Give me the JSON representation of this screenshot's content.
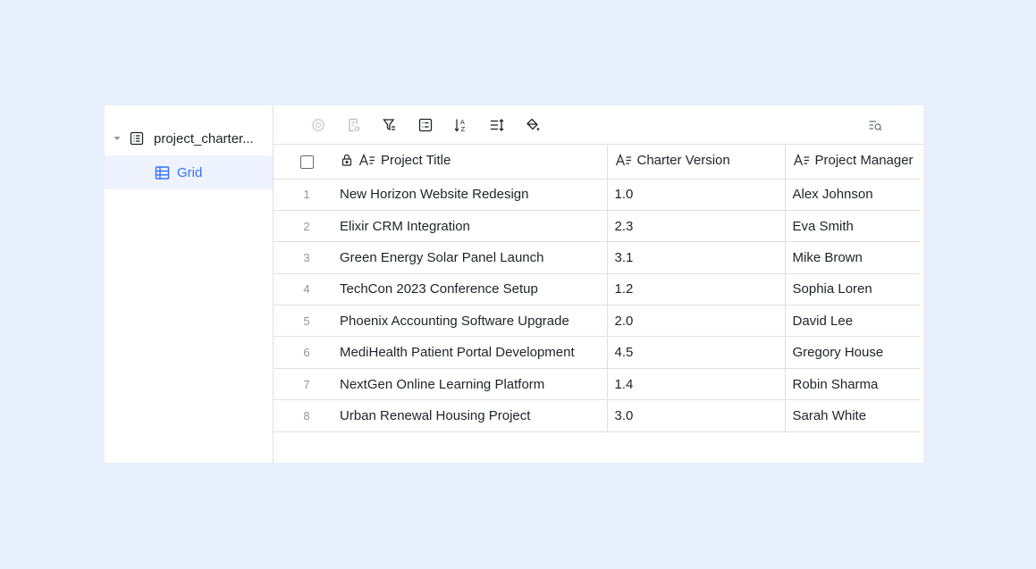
{
  "sidebar": {
    "table_name": "project_charter...",
    "view_name": "Grid"
  },
  "toolbar": {
    "icons": [
      "settings-icon",
      "record-icon",
      "filter-icon",
      "group-icon",
      "sort-icon",
      "row-height-icon",
      "fill-color-icon",
      "search-icon"
    ]
  },
  "grid": {
    "headers": {
      "title": "Project Title",
      "version": "Charter Version",
      "manager": "Project Manager"
    },
    "rows": [
      {
        "num": "1",
        "title": "New Horizon Website Redesign",
        "version": "1.0",
        "manager": "Alex Johnson"
      },
      {
        "num": "2",
        "title": "Elixir CRM Integration",
        "version": "2.3",
        "manager": "Eva Smith"
      },
      {
        "num": "3",
        "title": "Green Energy Solar Panel Launch",
        "version": "3.1",
        "manager": "Mike Brown"
      },
      {
        "num": "4",
        "title": "TechCon 2023 Conference Setup",
        "version": "1.2",
        "manager": "Sophia Loren"
      },
      {
        "num": "5",
        "title": "Phoenix Accounting Software Upgrade",
        "version": "2.0",
        "manager": "David Lee"
      },
      {
        "num": "6",
        "title": "MediHealth Patient Portal Development",
        "version": "4.5",
        "manager": "Gregory House"
      },
      {
        "num": "7",
        "title": "NextGen Online Learning Platform",
        "version": "1.4",
        "manager": "Robin Sharma"
      },
      {
        "num": "8",
        "title": "Urban Renewal Housing Project",
        "version": "3.0",
        "manager": "Sarah White"
      }
    ]
  },
  "colors": {
    "background": "#e8effc",
    "accent": "#3370ff",
    "selected_view_bg": "#eef3ff",
    "border": "#dee0e3"
  }
}
